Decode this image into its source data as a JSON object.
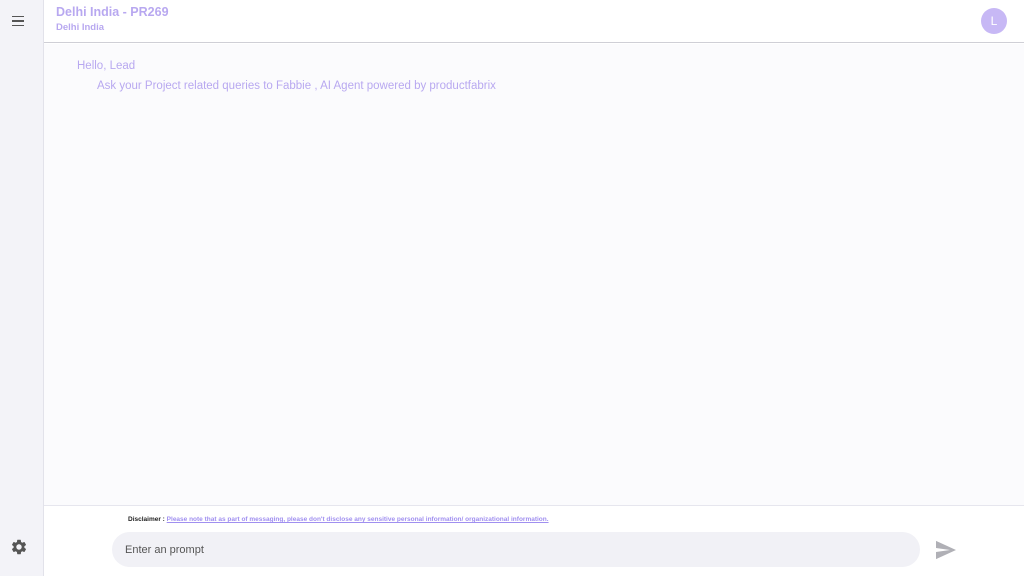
{
  "sidebar": {
    "menu_icon": "hamburger-menu-icon",
    "settings_icon": "gear-icon"
  },
  "header": {
    "title": "Delhi India - PR269",
    "subtitle": "Delhi India",
    "avatar_initial": "L"
  },
  "chat": {
    "greeting": "Hello, Lead",
    "intro": "Ask your Project related queries to Fabbie , AI Agent powered by productfabrix"
  },
  "footer": {
    "disclaimer_label": "Disclaimer :",
    "disclaimer_text": "Please note that as part of messaging, please don't disclose any sensitive personal information/ organizational information.",
    "prompt_placeholder": "Enter an prompt",
    "send_icon": "send-icon"
  },
  "colors": {
    "accent": "#b8a8f0",
    "avatar_bg": "#c7b8f5",
    "sidebar_bg": "#f3f3f8"
  }
}
